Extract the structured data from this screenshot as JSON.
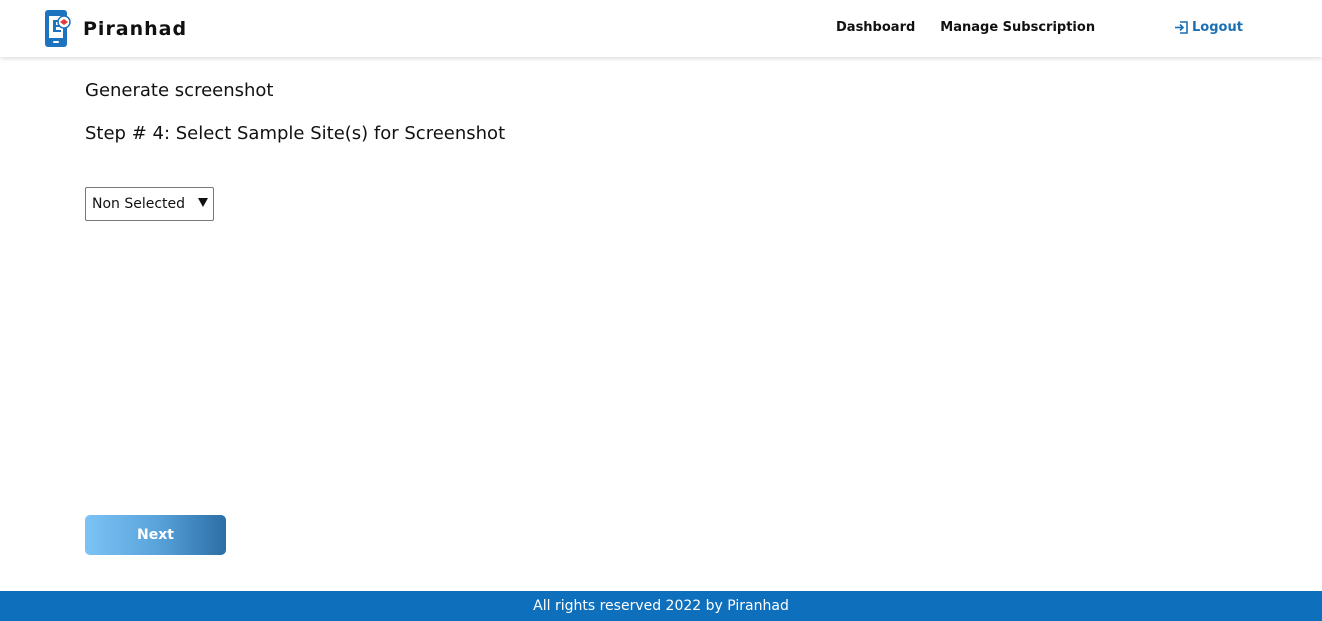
{
  "header": {
    "brand": "Piranhad",
    "nav": {
      "dashboard": "Dashboard",
      "manage_subscription": "Manage Subscription",
      "logout": "Logout"
    },
    "icons": {
      "logo": "piranhad-logo-icon",
      "logout": "logout-icon"
    },
    "colors": {
      "logout": "#1b6fb3"
    }
  },
  "main": {
    "title": "Generate screenshot",
    "step": "Step # 4: Select Sample Site(s) for Screenshot",
    "site_select": {
      "selected": "Non Selected"
    },
    "next_label": "Next"
  },
  "footer": {
    "text": "All rights reserved 2022 by Piranhad",
    "color": "#0e6fbd"
  }
}
